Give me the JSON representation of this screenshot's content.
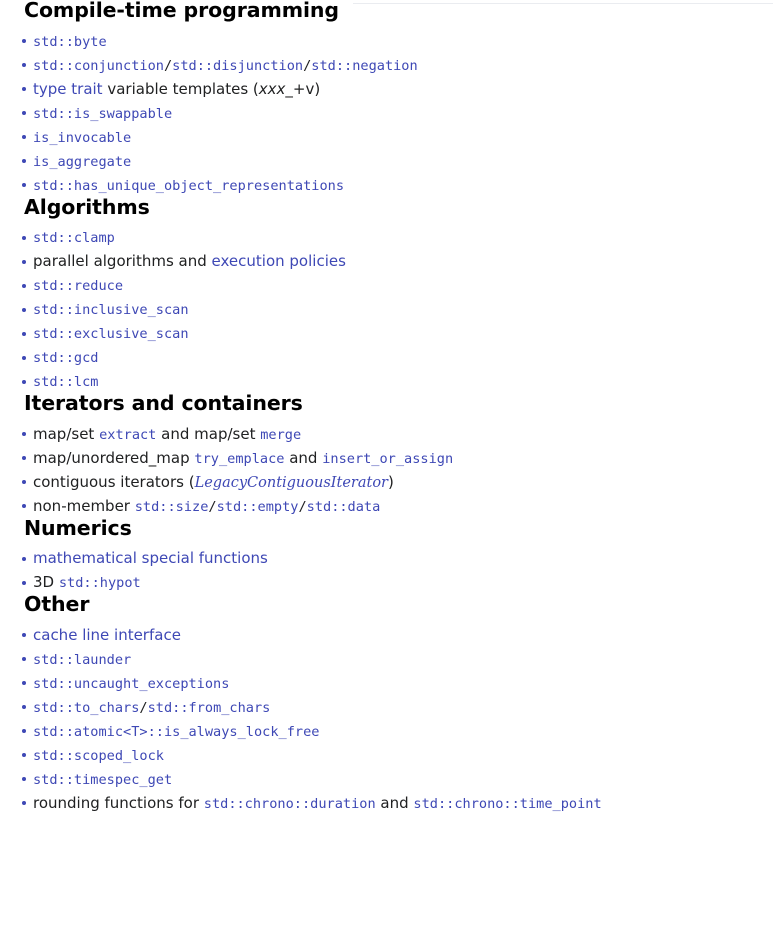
{
  "accent_color": "#3e48b5",
  "text_color": "#202122",
  "rule_color": "#eaecf0",
  "sections": [
    {
      "id": "compile-time-programming",
      "heading": "Compile-time programming",
      "items": [
        {
          "id": "std-byte",
          "runs": [
            {
              "text": "std::byte",
              "style": "codelink"
            }
          ]
        },
        {
          "id": "std-conjunction-disjunction-negation",
          "runs": [
            {
              "text": "std::conjunction",
              "style": "codelink"
            },
            {
              "text": "/",
              "style": "code"
            },
            {
              "text": "std::disjunction",
              "style": "codelink"
            },
            {
              "text": "/",
              "style": "code"
            },
            {
              "text": "std::negation",
              "style": "codelink"
            }
          ]
        },
        {
          "id": "type-trait-variable-templates",
          "runs": [
            {
              "text": "type trait",
              "style": "link"
            },
            {
              "text": " variable templates (",
              "style": "plain"
            },
            {
              "text": "xxx",
              "style": "plain-italic"
            },
            {
              "text": "_",
              "style": "plain"
            },
            {
              "text": "+v)",
              "style": "plain"
            }
          ]
        },
        {
          "id": "std-is-swappable",
          "runs": [
            {
              "text": "std::is_swappable",
              "style": "codelink"
            }
          ]
        },
        {
          "id": "is-invocable",
          "runs": [
            {
              "text": "is_invocable",
              "style": "codelink"
            }
          ]
        },
        {
          "id": "is-aggregate",
          "runs": [
            {
              "text": "is_aggregate",
              "style": "codelink"
            }
          ]
        },
        {
          "id": "std-has-unique-object-representations",
          "runs": [
            {
              "text": "std::has_unique_object_representations",
              "style": "codelink"
            }
          ]
        }
      ]
    },
    {
      "id": "algorithms",
      "heading": "Algorithms",
      "items": [
        {
          "id": "std-clamp",
          "runs": [
            {
              "text": "std::clamp",
              "style": "codelink"
            }
          ]
        },
        {
          "id": "parallel-algorithms",
          "runs": [
            {
              "text": "parallel algorithms",
              "style": "plain"
            },
            {
              "text": " and ",
              "style": "plain"
            },
            {
              "text": "execution policies",
              "style": "link"
            }
          ]
        },
        {
          "id": "std-reduce",
          "runs": [
            {
              "text": "std::reduce",
              "style": "codelink"
            }
          ]
        },
        {
          "id": "std-inclusive-scan",
          "runs": [
            {
              "text": "std::inclusive_scan",
              "style": "codelink"
            }
          ]
        },
        {
          "id": "std-exclusive-scan",
          "runs": [
            {
              "text": "std::exclusive_scan",
              "style": "codelink"
            }
          ]
        },
        {
          "id": "std-gcd",
          "runs": [
            {
              "text": "std::gcd",
              "style": "codelink"
            }
          ]
        },
        {
          "id": "std-lcm",
          "runs": [
            {
              "text": "std::lcm",
              "style": "codelink"
            }
          ]
        }
      ]
    },
    {
      "id": "iterators-and-containers",
      "heading": "Iterators and containers",
      "items": [
        {
          "id": "map-set-extract-merge",
          "runs": [
            {
              "text": "map/set ",
              "style": "plain"
            },
            {
              "text": "extract",
              "style": "codelink"
            },
            {
              "text": " and ",
              "style": "plain"
            },
            {
              "text": "map/set ",
              "style": "plain"
            },
            {
              "text": "merge",
              "style": "codelink"
            }
          ]
        },
        {
          "id": "try-emplace-insert-or-assign",
          "runs": [
            {
              "text": "map/unordered_map ",
              "style": "plain"
            },
            {
              "text": "try_emplace",
              "style": "codelink"
            },
            {
              "text": " and ",
              "style": "plain"
            },
            {
              "text": "insert_or_assign",
              "style": "codelink"
            }
          ]
        },
        {
          "id": "contiguous-iterators",
          "runs": [
            {
              "text": "contiguous iterators (",
              "style": "plain"
            },
            {
              "text": "LegacyContiguousIterator",
              "style": "serif-italic-link"
            },
            {
              "text": ")",
              "style": "plain"
            }
          ]
        },
        {
          "id": "non-member-size-empty-data",
          "runs": [
            {
              "text": "non-member ",
              "style": "plain"
            },
            {
              "text": "std::size",
              "style": "codelink"
            },
            {
              "text": "/",
              "style": "code"
            },
            {
              "text": "std::empty",
              "style": "codelink"
            },
            {
              "text": "/",
              "style": "code"
            },
            {
              "text": "std::data",
              "style": "codelink"
            }
          ]
        }
      ]
    },
    {
      "id": "numerics",
      "heading": "Numerics",
      "items": [
        {
          "id": "mathematical-special-functions",
          "runs": [
            {
              "text": "mathematical special functions",
              "style": "link"
            }
          ]
        },
        {
          "id": "3d-std-hypot",
          "runs": [
            {
              "text": "3D ",
              "style": "plain"
            },
            {
              "text": "std::hypot",
              "style": "codelink"
            }
          ]
        }
      ]
    },
    {
      "id": "other",
      "heading": "Other",
      "items": [
        {
          "id": "cache-line-interface",
          "runs": [
            {
              "text": "cache line interface",
              "style": "link"
            }
          ]
        },
        {
          "id": "std-launder",
          "runs": [
            {
              "text": "std::launder",
              "style": "codelink"
            }
          ]
        },
        {
          "id": "std-uncaught-exceptions",
          "runs": [
            {
              "text": "std::uncaught_exceptions",
              "style": "codelink"
            }
          ]
        },
        {
          "id": "std-to-chars-from-chars",
          "runs": [
            {
              "text": "std::to_chars",
              "style": "codelink"
            },
            {
              "text": "/",
              "style": "code"
            },
            {
              "text": "std::from_chars",
              "style": "codelink"
            }
          ]
        },
        {
          "id": "std-atomic-is-always-lock-free",
          "runs": [
            {
              "text": "std::atomic<T>::is_always_lock_free",
              "style": "codelink"
            }
          ]
        },
        {
          "id": "std-scoped-lock",
          "runs": [
            {
              "text": "std::scoped_lock",
              "style": "codelink"
            }
          ]
        },
        {
          "id": "std-timespec-get",
          "runs": [
            {
              "text": "std::timespec_get",
              "style": "codelink"
            }
          ]
        },
        {
          "id": "rounding-functions-chrono",
          "runs": [
            {
              "text": "rounding functions for ",
              "style": "plain"
            },
            {
              "text": "std::chrono::duration",
              "style": "codelink"
            },
            {
              "text": " and ",
              "style": "plain"
            },
            {
              "text": "std::chrono::time_point",
              "style": "codelink"
            }
          ]
        }
      ]
    }
  ]
}
